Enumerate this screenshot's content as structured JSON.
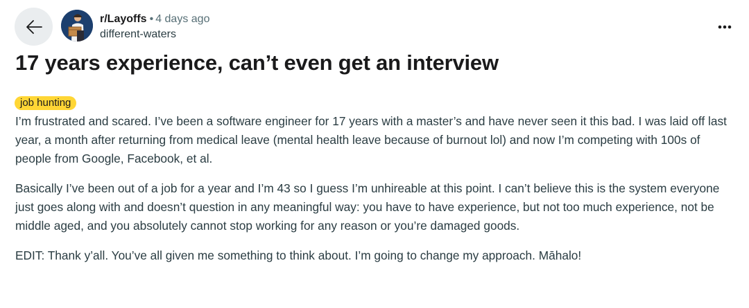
{
  "header": {
    "subreddit": "r/Layoffs",
    "separator": "•",
    "post_age": "4 days ago",
    "author": "different-waters"
  },
  "post": {
    "title": "17 years experience, can’t even get an interview",
    "flair": "job hunting",
    "flair_color": "#ffd635",
    "paragraphs": [
      "I’m frustrated and scared. I’ve been a software engineer for 17 years with a master’s and have never seen it this bad. I was laid off last year, a month after returning from medical leave (mental health leave because of burnout lol) and now I’m competing with 100s of people from Google, Facebook, et al.",
      "Basically I’ve been out of a job for a year and I’m 43 so I guess I’m unhireable at this point. I can’t believe this is the system everyone just goes along with and doesn’t question in any meaningful way: you have to have experience, but not too much experience, not be middle aged, and you absolutely cannot stop working for any reason or you’re damaged goods.",
      "EDIT: Thank y’all. You’ve all given me something to think about. I’m going to change my approach. Māhalo!"
    ]
  },
  "icons": {
    "back": "arrow-left-icon",
    "more": "more-horizontal-icon"
  }
}
